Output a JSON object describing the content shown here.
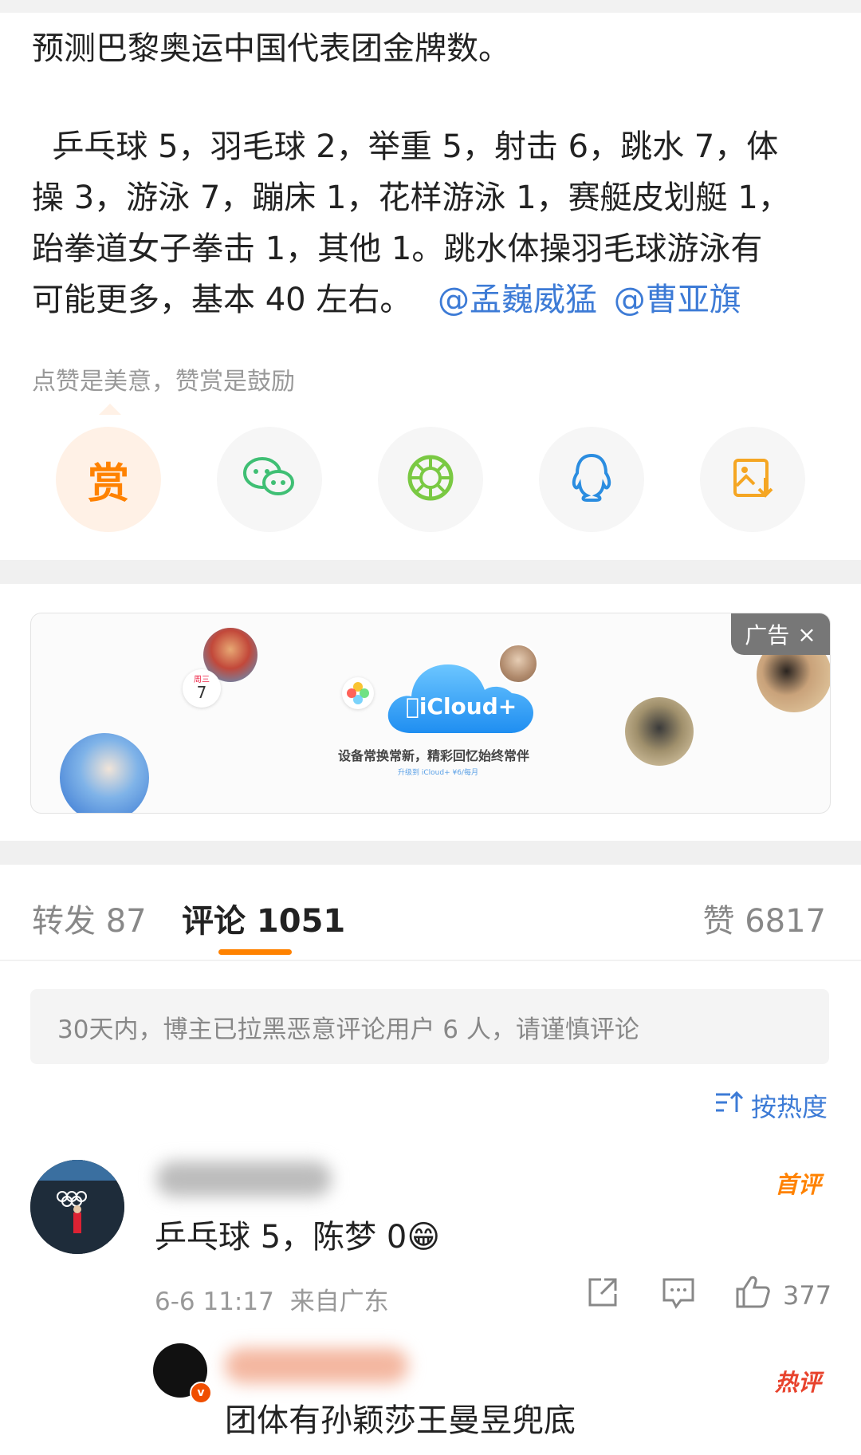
{
  "post": {
    "title": "预测巴黎奥运中国代表团金牌数。",
    "body_lines": [
      "  乒乓球 5，羽毛球 2，举重 5，射击 6，跳水 7，体",
      "操 3，游泳 7，蹦床 1，花样游泳 1，赛艇皮划艇 1，",
      "跆拳道女子拳击 1，其他 1。跳水体操羽毛球游泳有",
      "可能更多，基本 40 左右。"
    ],
    "mentions": [
      "@孟巍威猛",
      "@曹亚旗"
    ]
  },
  "reward": {
    "hint": "点赞是美意，赞赏是鼓励",
    "button_char": "赏"
  },
  "share_icons": [
    "wechat-icon",
    "moments-icon",
    "qq-icon",
    "save-image-icon"
  ],
  "ad": {
    "tag": "广告",
    "close": "×",
    "brand": "iCloud+",
    "slogan": "设备常换常新，精彩回忆始终常伴",
    "sub": "升级到 iCloud+ ¥6/每月",
    "calendar_weekday": "周三",
    "calendar_day": "7"
  },
  "tabs": {
    "repost": "转发 87",
    "comment": "评论 1051",
    "like": "赞 6817"
  },
  "notice": "30天内，博主已拉黑恶意评论用户 6 人，请谨慎评论",
  "sort_label": "按热度",
  "comments": [
    {
      "badge": "首评",
      "text": "乒乓球 5，陈梦 0",
      "emoji": "😁",
      "time": "6-6 11:17",
      "location": "来自广东",
      "likes": "377"
    },
    {
      "badge": "热评",
      "verified": "v",
      "text": "团体有孙颖莎王曼昱兜底"
    }
  ],
  "colors": {
    "accent": "#ff8200",
    "link": "#3d7bd6",
    "badge_first": "#ff8200",
    "badge_hot": "#e8432d"
  }
}
